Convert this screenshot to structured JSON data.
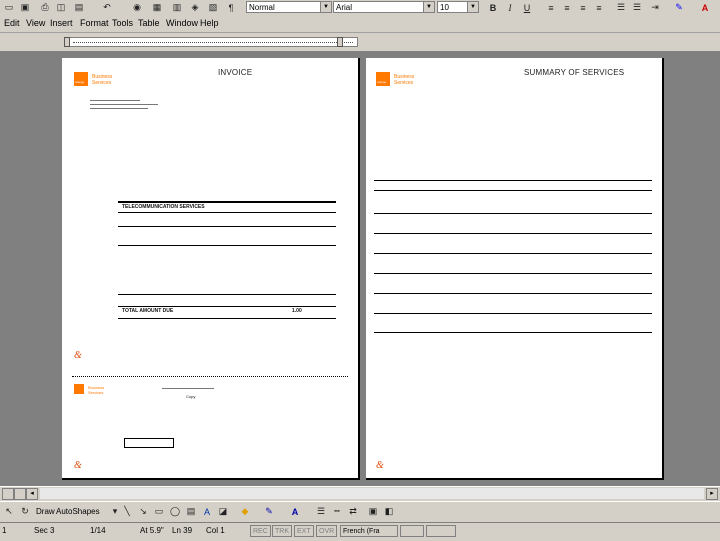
{
  "toolbar": {
    "style_value": "Normal",
    "font_value": "Arial",
    "size_value": "10",
    "bold": "B",
    "italic": "I",
    "underline": "U"
  },
  "menu": [
    "Edit",
    "View",
    "Insert",
    "Format",
    "Tools",
    "Table",
    "Window",
    "Help"
  ],
  "page1": {
    "title": "INVOICE",
    "company_line1": "Business",
    "company_line2": "Services",
    "logo_text": "orange",
    "section_title": "TELECOMMUNICATION SERVICES",
    "total_due_label": "TOTAL AMOUNT DUE",
    "total_due_value": "1.00",
    "footer_company1": "Business",
    "footer_company2": "Services",
    "footer_label": "Copy"
  },
  "page2": {
    "title": "SUMMARY OF SERVICES",
    "company_line1": "Business",
    "company_line2": "Services",
    "logo_text": "orange"
  },
  "drawing": {
    "draw_label": "Draw",
    "autoshapes_label": "AutoShapes"
  },
  "status": {
    "page": "1",
    "section": "Sec 3",
    "pages": "1/14",
    "at": "At 5.9\"",
    "line": "Ln 39",
    "col": "Col 1",
    "rec": "REC",
    "trk": "TRK",
    "ext": "EXT",
    "ovr": "OVR",
    "language": "French (Fra"
  }
}
